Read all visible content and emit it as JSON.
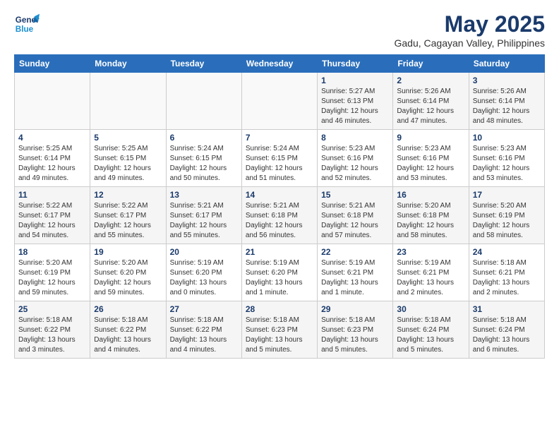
{
  "logo": {
    "line1": "General",
    "line2": "Blue"
  },
  "title": "May 2025",
  "location": "Gadu, Cagayan Valley, Philippines",
  "weekdays": [
    "Sunday",
    "Monday",
    "Tuesday",
    "Wednesday",
    "Thursday",
    "Friday",
    "Saturday"
  ],
  "weeks": [
    [
      {
        "day": "",
        "info": ""
      },
      {
        "day": "",
        "info": ""
      },
      {
        "day": "",
        "info": ""
      },
      {
        "day": "",
        "info": ""
      },
      {
        "day": "1",
        "info": "Sunrise: 5:27 AM\nSunset: 6:13 PM\nDaylight: 12 hours\nand 46 minutes."
      },
      {
        "day": "2",
        "info": "Sunrise: 5:26 AM\nSunset: 6:14 PM\nDaylight: 12 hours\nand 47 minutes."
      },
      {
        "day": "3",
        "info": "Sunrise: 5:26 AM\nSunset: 6:14 PM\nDaylight: 12 hours\nand 48 minutes."
      }
    ],
    [
      {
        "day": "4",
        "info": "Sunrise: 5:25 AM\nSunset: 6:14 PM\nDaylight: 12 hours\nand 49 minutes."
      },
      {
        "day": "5",
        "info": "Sunrise: 5:25 AM\nSunset: 6:15 PM\nDaylight: 12 hours\nand 49 minutes."
      },
      {
        "day": "6",
        "info": "Sunrise: 5:24 AM\nSunset: 6:15 PM\nDaylight: 12 hours\nand 50 minutes."
      },
      {
        "day": "7",
        "info": "Sunrise: 5:24 AM\nSunset: 6:15 PM\nDaylight: 12 hours\nand 51 minutes."
      },
      {
        "day": "8",
        "info": "Sunrise: 5:23 AM\nSunset: 6:16 PM\nDaylight: 12 hours\nand 52 minutes."
      },
      {
        "day": "9",
        "info": "Sunrise: 5:23 AM\nSunset: 6:16 PM\nDaylight: 12 hours\nand 53 minutes."
      },
      {
        "day": "10",
        "info": "Sunrise: 5:23 AM\nSunset: 6:16 PM\nDaylight: 12 hours\nand 53 minutes."
      }
    ],
    [
      {
        "day": "11",
        "info": "Sunrise: 5:22 AM\nSunset: 6:17 PM\nDaylight: 12 hours\nand 54 minutes."
      },
      {
        "day": "12",
        "info": "Sunrise: 5:22 AM\nSunset: 6:17 PM\nDaylight: 12 hours\nand 55 minutes."
      },
      {
        "day": "13",
        "info": "Sunrise: 5:21 AM\nSunset: 6:17 PM\nDaylight: 12 hours\nand 55 minutes."
      },
      {
        "day": "14",
        "info": "Sunrise: 5:21 AM\nSunset: 6:18 PM\nDaylight: 12 hours\nand 56 minutes."
      },
      {
        "day": "15",
        "info": "Sunrise: 5:21 AM\nSunset: 6:18 PM\nDaylight: 12 hours\nand 57 minutes."
      },
      {
        "day": "16",
        "info": "Sunrise: 5:20 AM\nSunset: 6:18 PM\nDaylight: 12 hours\nand 58 minutes."
      },
      {
        "day": "17",
        "info": "Sunrise: 5:20 AM\nSunset: 6:19 PM\nDaylight: 12 hours\nand 58 minutes."
      }
    ],
    [
      {
        "day": "18",
        "info": "Sunrise: 5:20 AM\nSunset: 6:19 PM\nDaylight: 12 hours\nand 59 minutes."
      },
      {
        "day": "19",
        "info": "Sunrise: 5:20 AM\nSunset: 6:20 PM\nDaylight: 12 hours\nand 59 minutes."
      },
      {
        "day": "20",
        "info": "Sunrise: 5:19 AM\nSunset: 6:20 PM\nDaylight: 13 hours\nand 0 minutes."
      },
      {
        "day": "21",
        "info": "Sunrise: 5:19 AM\nSunset: 6:20 PM\nDaylight: 13 hours\nand 1 minute."
      },
      {
        "day": "22",
        "info": "Sunrise: 5:19 AM\nSunset: 6:21 PM\nDaylight: 13 hours\nand 1 minute."
      },
      {
        "day": "23",
        "info": "Sunrise: 5:19 AM\nSunset: 6:21 PM\nDaylight: 13 hours\nand 2 minutes."
      },
      {
        "day": "24",
        "info": "Sunrise: 5:18 AM\nSunset: 6:21 PM\nDaylight: 13 hours\nand 2 minutes."
      }
    ],
    [
      {
        "day": "25",
        "info": "Sunrise: 5:18 AM\nSunset: 6:22 PM\nDaylight: 13 hours\nand 3 minutes."
      },
      {
        "day": "26",
        "info": "Sunrise: 5:18 AM\nSunset: 6:22 PM\nDaylight: 13 hours\nand 4 minutes."
      },
      {
        "day": "27",
        "info": "Sunrise: 5:18 AM\nSunset: 6:22 PM\nDaylight: 13 hours\nand 4 minutes."
      },
      {
        "day": "28",
        "info": "Sunrise: 5:18 AM\nSunset: 6:23 PM\nDaylight: 13 hours\nand 5 minutes."
      },
      {
        "day": "29",
        "info": "Sunrise: 5:18 AM\nSunset: 6:23 PM\nDaylight: 13 hours\nand 5 minutes."
      },
      {
        "day": "30",
        "info": "Sunrise: 5:18 AM\nSunset: 6:24 PM\nDaylight: 13 hours\nand 5 minutes."
      },
      {
        "day": "31",
        "info": "Sunrise: 5:18 AM\nSunset: 6:24 PM\nDaylight: 13 hours\nand 6 minutes."
      }
    ]
  ]
}
